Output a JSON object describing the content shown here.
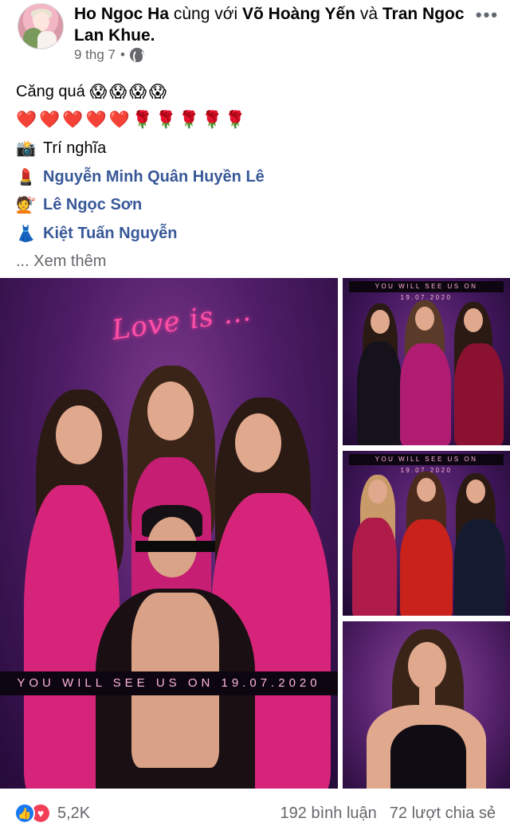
{
  "post": {
    "author": "Ho Ngoc Ha",
    "with_text": "cùng với",
    "tagged_1": "Võ Hoàng Yến",
    "and_text": "và",
    "tagged_2": "Tran Ngoc Lan Khue.",
    "time": "9 thg 7",
    "dot": "•",
    "privacy_icon": "globe-icon",
    "more_icon": "ellipsis-icon"
  },
  "content": {
    "line1_text": "Căng quá",
    "line1_emojis": [
      "😱",
      "😱",
      "😱",
      "😱"
    ],
    "line2_emojis": [
      "❤️",
      "❤️",
      "❤️",
      "❤️",
      "❤️",
      "🌹",
      "🌹",
      "🌹",
      "🌹",
      "🌹"
    ],
    "credits": [
      {
        "icon": "📸",
        "icon_name": "camera-flash-icon",
        "text": "Trí nghĩa",
        "linked": false
      },
      {
        "icon": "💄",
        "icon_name": "lipstick-icon",
        "text": "Nguyễn Minh Quân Huyền Lê",
        "linked": true
      },
      {
        "icon": "💇",
        "icon_name": "haircut-icon",
        "text": "Lê Ngọc Sơn",
        "linked": true
      },
      {
        "icon": "👗",
        "icon_name": "dress-icon",
        "text": "Kiệt Tuấn Nguyễn",
        "linked": true
      }
    ],
    "see_more": "... Xem thêm"
  },
  "photos": {
    "main_script_text": "Love is ...",
    "main_banner": "YOU WILL SEE US ON 19.07.2020",
    "thumb1_banner": "YOU WILL SEE US ON 19.07.2020",
    "thumb2_banner": "YOU WILL SEE US ON 19.07.2020"
  },
  "footer": {
    "reaction_count": "5,2K",
    "comments": "192 bình luận",
    "shares": "72 lượt chia sẻ"
  },
  "colors": {
    "link": "#385898",
    "muted": "#65676b",
    "like_blue": "#1877f2",
    "love_red": "#f33e58",
    "dress_pink": "#d6247a"
  }
}
